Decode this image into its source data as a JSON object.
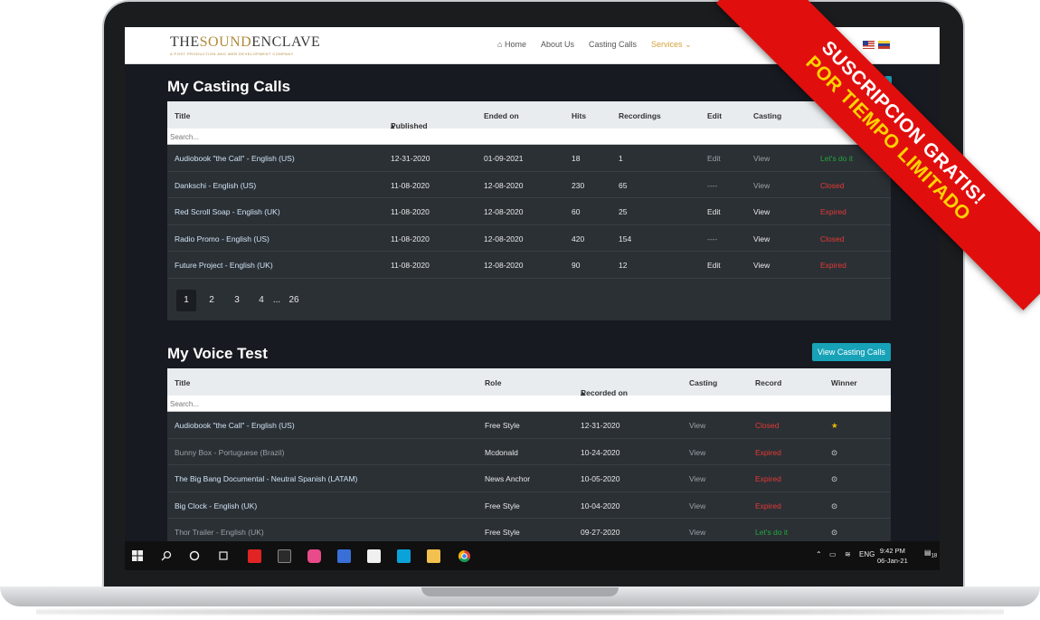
{
  "nav": {
    "logo_left": "THE",
    "logo_mid": "SOUND",
    "logo_right": "ENCLAVE",
    "logo_tagline": "A POST PRODUCTION AND WEB DEVELOPMENT COMPANY",
    "home": "Home",
    "about": "About Us",
    "casting": "Casting Calls",
    "services": "Services"
  },
  "casting_calls": {
    "title": "My Casting Calls",
    "headers": [
      "Title",
      "Published",
      "Ended on",
      "Hits",
      "Recordings",
      "Edit",
      "Casting"
    ],
    "search_placeholder": "Search...",
    "rows": [
      {
        "title": "Audiobook \"the Call\" - English (US)",
        "published": "12-31-2020",
        "ended": "01-09-2021",
        "hits": "18",
        "recordings": "1",
        "edit": "Edit",
        "casting": "View",
        "status": "Let's do it"
      },
      {
        "title": "Dankschi - English (US)",
        "published": "11-08-2020",
        "ended": "12-08-2020",
        "hits": "230",
        "recordings": "65",
        "edit": "----",
        "casting": "View",
        "status": "Closed"
      },
      {
        "title": "Red Scroll Soap - English (UK)",
        "published": "11-08-2020",
        "ended": "12-08-2020",
        "hits": "60",
        "recordings": "25",
        "edit": "Edit",
        "casting": "View",
        "status": "Expired"
      },
      {
        "title": "Radio Promo - English (US)",
        "published": "11-08-2020",
        "ended": "12-08-2020",
        "hits": "420",
        "recordings": "154",
        "edit": "----",
        "casting": "View",
        "status": "Closed"
      },
      {
        "title": "Future Project - English (UK)",
        "published": "11-08-2020",
        "ended": "12-08-2020",
        "hits": "90",
        "recordings": "12",
        "edit": "Edit",
        "casting": "View",
        "status": "Expired"
      }
    ],
    "pages": [
      "1",
      "2",
      "3",
      "4",
      "...",
      "26"
    ]
  },
  "voice_test": {
    "title": "My Voice Test",
    "button": "View Casting Calls",
    "headers": [
      "Title",
      "Role",
      "Recorded on",
      "Casting",
      "Record",
      "Winner"
    ],
    "search_placeholder": "Search...",
    "rows": [
      {
        "title": "Audiobook \"the Call\" - English (US)",
        "role": "Free Style",
        "recorded": "12-31-2020",
        "casting": "View",
        "record": "Closed",
        "winner": "★"
      },
      {
        "title": "Bunny Box - Portuguese (Brazil)",
        "role": "Mcdonald",
        "recorded": "10-24-2020",
        "casting": "View",
        "record": "Expired",
        "winner": "⊙"
      },
      {
        "title": "The Big Bang Documental - Neutral Spanish (LATAM)",
        "role": "News Anchor",
        "recorded": "10-05-2020",
        "casting": "View",
        "record": "Expired",
        "winner": "⊙"
      },
      {
        "title": "Big Clock - English (UK)",
        "role": "Free Style",
        "recorded": "10-04-2020",
        "casting": "View",
        "record": "Expired",
        "winner": "⊙"
      },
      {
        "title": "Thor Trailer - English (UK)",
        "role": "Free Style",
        "recorded": "09-27-2020",
        "casting": "View",
        "record": "Let's do it",
        "winner": "⊙"
      }
    ]
  },
  "taskbar": {
    "lang": "ENG",
    "time": "9:42 PM",
    "date": "06-Jan-21",
    "notif_count": "18"
  },
  "promo": {
    "line1": "SUSCRIPCION GRATIS!",
    "line2": "POR TIEMPO LIMITADO"
  },
  "colors": {
    "accent": "#17a2b8",
    "danger": "#e53935",
    "success": "#22a83a",
    "nav_active": "#d4a23a",
    "ribbon": "#e10e0e"
  }
}
